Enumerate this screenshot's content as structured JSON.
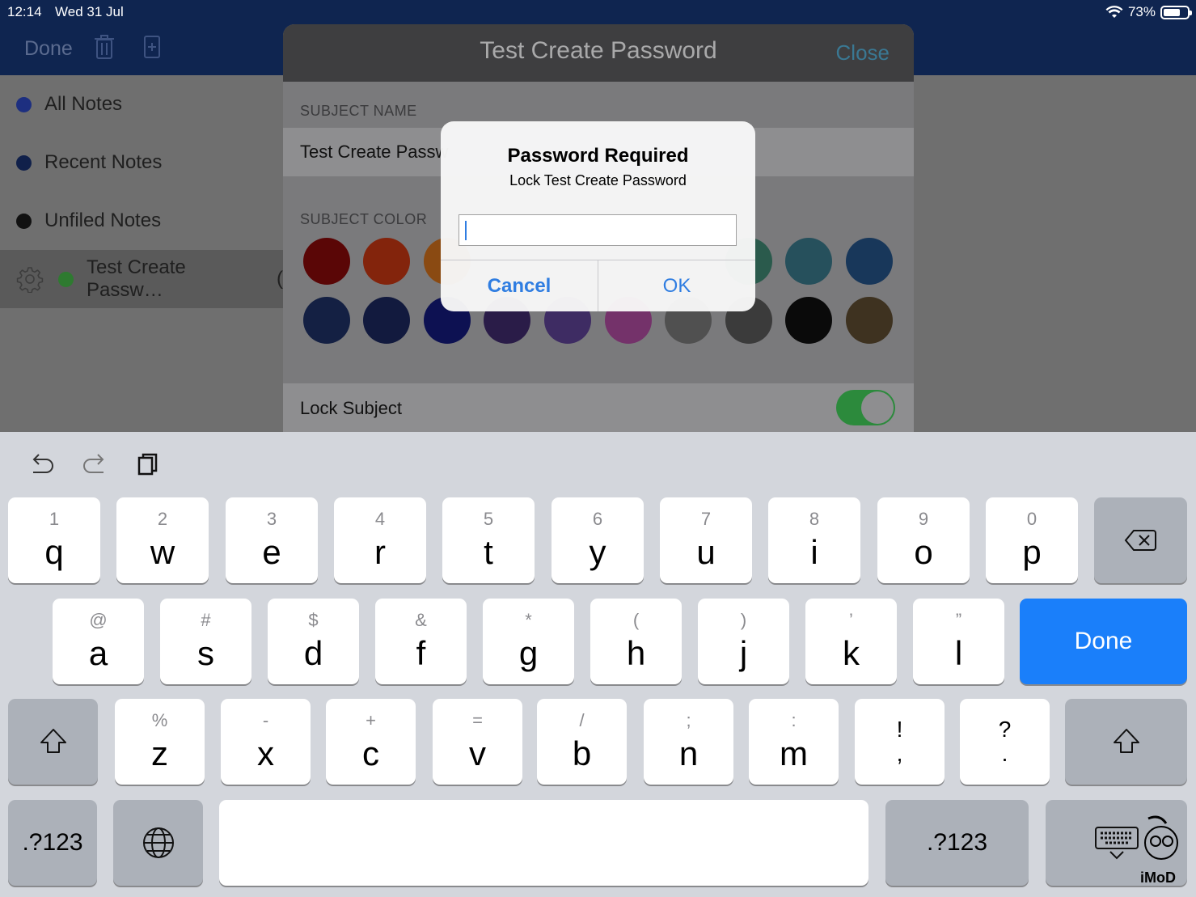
{
  "status_bar": {
    "time": "12:14",
    "date": "Wed 31 Jul",
    "battery": "73%",
    "battery_level": 0.73
  },
  "nav": {
    "done_label": "Done"
  },
  "sidebar": {
    "items": [
      {
        "label": "All Notes",
        "dot_color": "#1d2f80"
      },
      {
        "label": "Recent Notes",
        "dot_color": "#10204a"
      },
      {
        "label": "Unfiled Notes",
        "dot_color": "#111111"
      },
      {
        "label": "Test Create Passw…",
        "dot_color": "#2e7a30",
        "selected": true
      }
    ],
    "peek_text": "("
  },
  "sheet": {
    "title": "Test Create Password",
    "close_label": "Close",
    "subject_name_label": "SUBJECT NAME",
    "subject_name_value": "Test Create Passw",
    "subject_color_label": "SUBJECT COLOR",
    "colors_row1": [
      "#5a0606",
      "#83240c",
      "#8a4a12",
      "#2a5a4c",
      "#26505c",
      "#18375a"
    ],
    "colors_row2": [
      "#142043",
      "#121a3e",
      "#0d1152",
      "#2a1c48",
      "#3e2c63",
      "#74326a",
      "#505050",
      "#3b3b3b",
      "#0a0a0a",
      "#3e3220"
    ],
    "lock_label": "Lock Subject",
    "lock_on": true,
    "accent_close": "#3a7893"
  },
  "alert": {
    "title": "Password Required",
    "message": "Lock Test Create Password",
    "input_value": "",
    "cancel_label": "Cancel",
    "ok_label": "OK",
    "button_color": "#2f7de1"
  },
  "keyboard": {
    "toolbar": [
      "undo-icon",
      "redo-icon",
      "paste-icon"
    ],
    "row1": [
      {
        "main": "q",
        "hint": "1"
      },
      {
        "main": "w",
        "hint": "2"
      },
      {
        "main": "e",
        "hint": "3"
      },
      {
        "main": "r",
        "hint": "4"
      },
      {
        "main": "t",
        "hint": "5"
      },
      {
        "main": "y",
        "hint": "6"
      },
      {
        "main": "u",
        "hint": "7"
      },
      {
        "main": "i",
        "hint": "8"
      },
      {
        "main": "o",
        "hint": "9"
      },
      {
        "main": "p",
        "hint": "0"
      }
    ],
    "row2": [
      {
        "main": "a",
        "hint": "@"
      },
      {
        "main": "s",
        "hint": "#"
      },
      {
        "main": "d",
        "hint": "$"
      },
      {
        "main": "f",
        "hint": "&"
      },
      {
        "main": "g",
        "hint": "*"
      },
      {
        "main": "h",
        "hint": "("
      },
      {
        "main": "j",
        "hint": ")"
      },
      {
        "main": "k",
        "hint": "’"
      },
      {
        "main": "l",
        "hint": "”"
      }
    ],
    "row3": [
      {
        "main": "z",
        "hint": "%"
      },
      {
        "main": "x",
        "hint": "-"
      },
      {
        "main": "c",
        "hint": "+"
      },
      {
        "main": "v",
        "hint": "="
      },
      {
        "main": "b",
        "hint": "/"
      },
      {
        "main": "n",
        "hint": ";"
      },
      {
        "main": "m",
        "hint": ":"
      }
    ],
    "punct": [
      {
        "top": "!",
        "bottom": ","
      },
      {
        "top": "?",
        "bottom": "."
      }
    ],
    "done_label": "Done",
    "numbers_label": ".?123",
    "done_color": "#1a7ffa"
  },
  "watermark": "iMoD"
}
